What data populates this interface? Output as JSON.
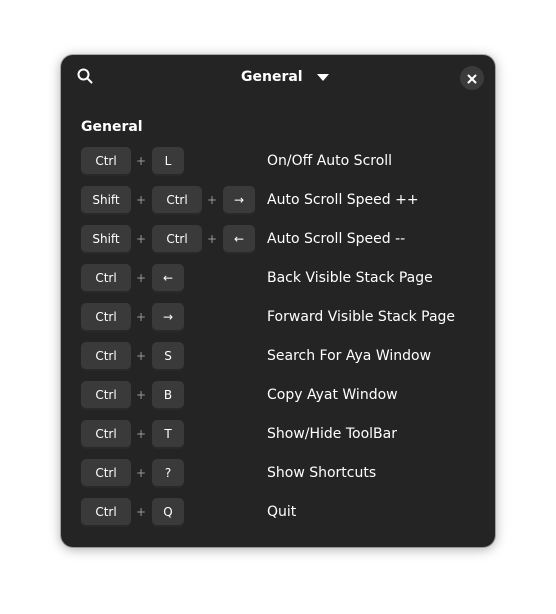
{
  "header": {
    "title": "General",
    "search_icon": "search-icon",
    "close_icon": "close-icon",
    "dropdown_icon": "chevron-down-icon"
  },
  "section": {
    "title": "General"
  },
  "shortcuts": [
    {
      "keys": [
        "Ctrl",
        "L"
      ],
      "description": "On/Off Auto Scroll"
    },
    {
      "keys": [
        "Shift",
        "Ctrl",
        "→"
      ],
      "description": "Auto Scroll Speed ++"
    },
    {
      "keys": [
        "Shift",
        "Ctrl",
        "←"
      ],
      "description": "Auto Scroll Speed --"
    },
    {
      "keys": [
        "Ctrl",
        "←"
      ],
      "description": "Back Visible Stack Page"
    },
    {
      "keys": [
        "Ctrl",
        "→"
      ],
      "description": "Forward Visible Stack Page"
    },
    {
      "keys": [
        "Ctrl",
        "S"
      ],
      "description": "Search For Aya Window"
    },
    {
      "keys": [
        "Ctrl",
        "B"
      ],
      "description": "Copy Ayat Window"
    },
    {
      "keys": [
        "Ctrl",
        "T"
      ],
      "description": "Show/Hide ToolBar"
    },
    {
      "keys": [
        "Ctrl",
        "?"
      ],
      "description": "Show Shortcuts"
    },
    {
      "keys": [
        "Ctrl",
        "Q"
      ],
      "description": "Quit"
    }
  ],
  "plus_symbol": "+",
  "colors": {
    "window_bg": "#242424",
    "key_bg": "#3a3a3a",
    "text": "#ffffff",
    "plus": "#9a9a9a"
  }
}
